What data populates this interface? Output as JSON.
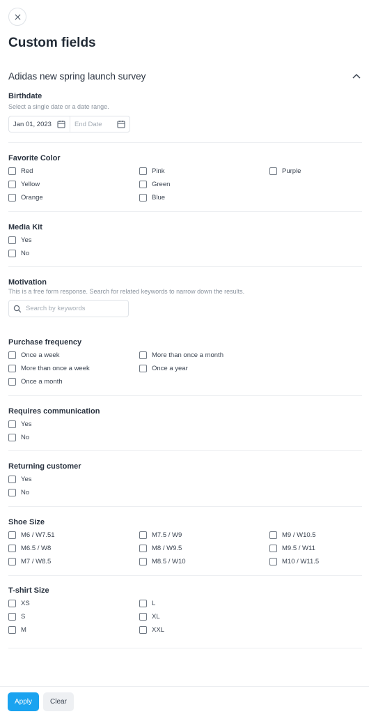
{
  "page": {
    "title": "Custom fields"
  },
  "survey": {
    "title": "Adidas new spring launch survey"
  },
  "birthdate": {
    "label": "Birthdate",
    "help": "Select a single date or a date range.",
    "start_value": "Jan 01, 2023",
    "end_placeholder": "End Date"
  },
  "favorite_color": {
    "label": "Favorite Color",
    "options": [
      "Red",
      "Yellow",
      "Orange",
      "Pink",
      "Green",
      "Blue",
      "Purple"
    ]
  },
  "media_kit": {
    "label": "Media Kit",
    "options": [
      "Yes",
      "No"
    ]
  },
  "motivation": {
    "label": "Motivation",
    "help": "This is a free form response. Search for related keywords to narrow down the results.",
    "search_placeholder": "Search by keywords"
  },
  "purchase_frequency": {
    "label": "Purchase frequency",
    "options": [
      "Once a week",
      "More than once a week",
      "Once a month",
      "More than once a month",
      "Once a year"
    ]
  },
  "requires_communication": {
    "label": "Requires communication",
    "options": [
      "Yes",
      "No"
    ]
  },
  "returning_customer": {
    "label": "Returning customer",
    "options": [
      "Yes",
      "No"
    ]
  },
  "shoe_size": {
    "label": "Shoe Size",
    "options": [
      "M6 / W7.51",
      "M6.5 / W8",
      "M7 / W8.5",
      "M7.5 / W9",
      "M8 / W9.5",
      "M8.5 / W10",
      "M9 / W10.5",
      "M9.5 / W11",
      "M10 / W11.5"
    ]
  },
  "tshirt_size": {
    "label": "T-shirt Size",
    "options": [
      "XS",
      "S",
      "M",
      "L",
      "XL",
      "XXL"
    ]
  },
  "footer": {
    "apply_label": "Apply",
    "clear_label": "Clear"
  },
  "icons": {
    "close": "close-icon",
    "collapse": "chevron-up-icon",
    "calendar": "calendar-icon",
    "search": "search-icon"
  },
  "colors": {
    "accent": "#1aa3f0",
    "text": "#1f2733",
    "border": "#dfe3e8"
  }
}
